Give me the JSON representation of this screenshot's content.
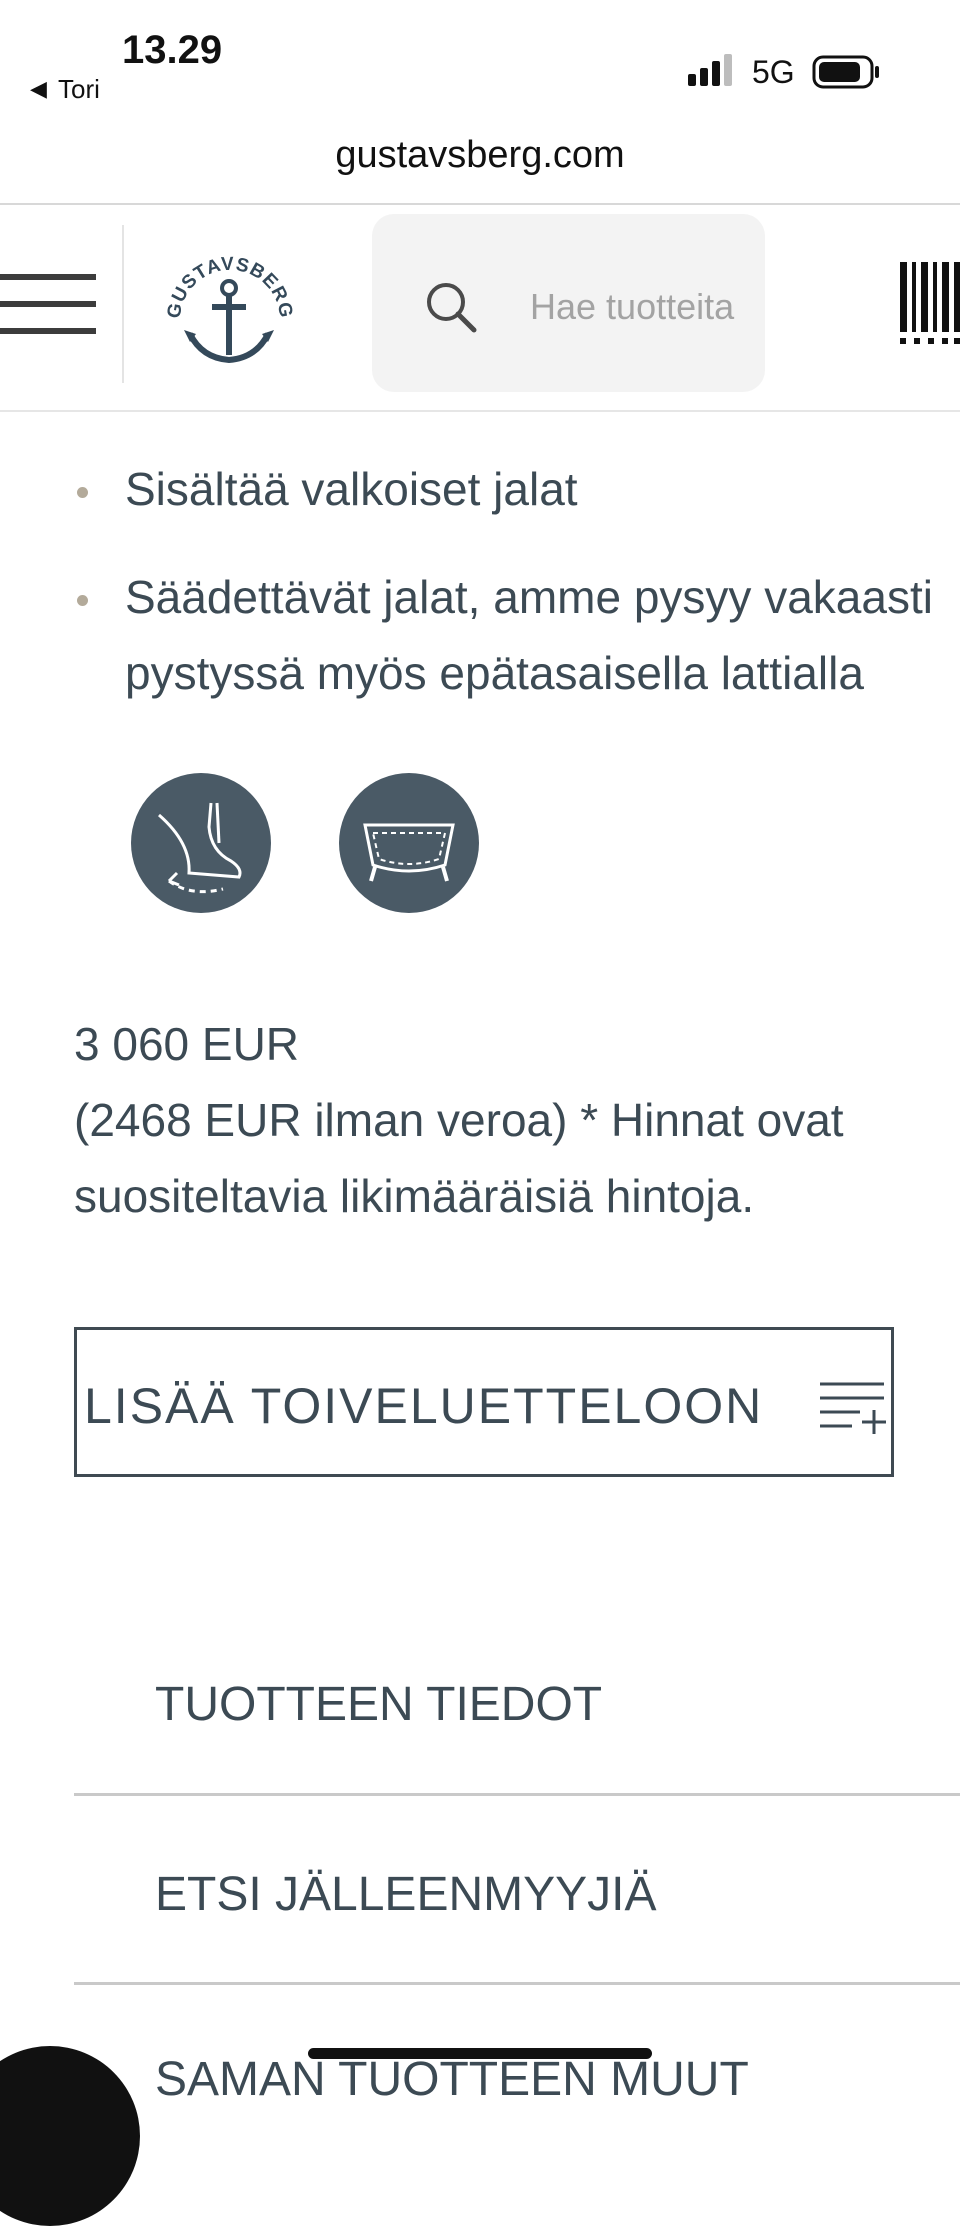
{
  "status_bar": {
    "time": "13.29",
    "back_arrow": "◀",
    "back_app": "Tori",
    "network": "5G",
    "icons": [
      "signal-icon",
      "battery-icon"
    ]
  },
  "browser": {
    "url": "gustavsberg.com"
  },
  "header": {
    "logo_text": "GUSTAVSBERG",
    "search_placeholder": "Hae tuotteita",
    "icons": [
      "menu-icon",
      "search-icon",
      "barcode-icon",
      "anchor-icon"
    ]
  },
  "features": [
    {
      "lines": [
        "Sisältää valkoiset jalat"
      ]
    },
    {
      "lines": [
        "Säädettävät jalat, amme pysyy vakaasti",
        "pystyssä myös epätasaisella lattialla"
      ]
    }
  ],
  "feature_icons": [
    "adjustable-foot-icon",
    "freestanding-bathtub-icon"
  ],
  "price": {
    "amount": "3 060 EUR",
    "note_line1": "(2468 EUR ilman veroa) * Hinnat ovat",
    "note_line2": "suositeltavia likimääräisiä hintoja."
  },
  "wishlist": {
    "label": "LISÄÄ TOIVELUETTELOON"
  },
  "accordion": {
    "items": [
      "TUOTTEEN TIEDOT",
      "ETSI JÄLLEENMYYJIÄ",
      "SAMAN TUOTTEEN MUUT"
    ]
  },
  "colors": {
    "text": "#3c4a54",
    "icon_circle": "#4a5a66",
    "bullet": "#b3aa9a",
    "search_bg": "#f3f3f3"
  }
}
